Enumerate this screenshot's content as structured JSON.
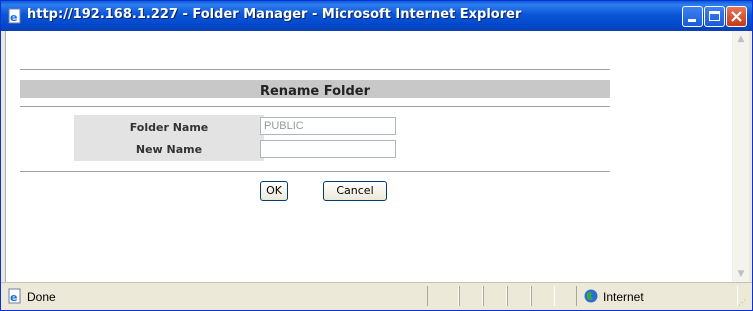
{
  "window": {
    "title": "http://192.168.1.227 - Folder Manager - Microsoft Internet Explorer"
  },
  "form": {
    "heading": "Rename Folder",
    "folder_name_label": "Folder Name",
    "folder_name_value": "PUBLIC",
    "new_name_label": "New Name",
    "new_name_value": "",
    "ok_label": "OK",
    "cancel_label": "Cancel"
  },
  "status_bar": {
    "status_text": "Done",
    "zone_text": "Internet"
  },
  "icons": {
    "title_icon": "ie-page-icon",
    "status_icon": "ie-page-icon",
    "zone_icon": "globe-icon"
  },
  "colors": {
    "titlebar": "#0a56d8",
    "heading_bar": "#c8c8c8",
    "label_cell": "#e3e3e3",
    "close_button": "#c33a17"
  }
}
